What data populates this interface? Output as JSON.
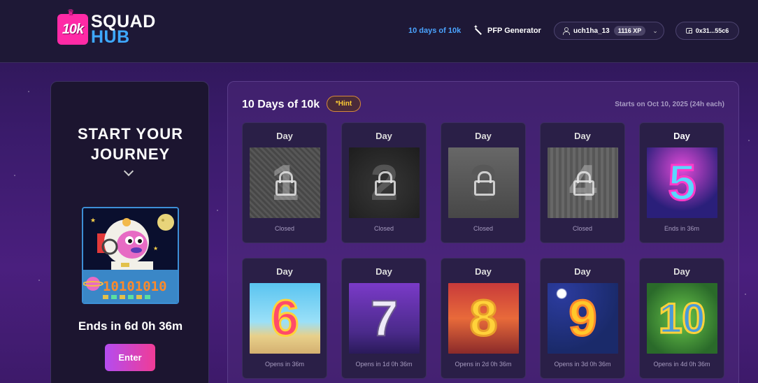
{
  "header": {
    "logo_badge": "10k",
    "logo_line1": "SQUAD",
    "logo_line2": "HUB",
    "nav_days": "10 days of 10k",
    "nav_pfp": "PFP Generator",
    "username": "uch1ha_13",
    "xp": "1116 XP",
    "wallet": "0x31...55c6"
  },
  "left": {
    "title_line1": "START YOUR",
    "title_line2": "JOURNEY",
    "nft_banner": "10101010",
    "ends": "Ends in 6d 0h 36m",
    "enter": "Enter"
  },
  "main": {
    "title": "10 Days of 10k",
    "hint": "*Hint",
    "starts": "Starts on Oct 10, 2025 (24h each)",
    "days": [
      {
        "label": "Day",
        "num": "1",
        "status": "Closed"
      },
      {
        "label": "Day",
        "num": "2",
        "status": "Closed"
      },
      {
        "label": "Day",
        "num": "3",
        "status": "Closed"
      },
      {
        "label": "Day",
        "num": "4",
        "status": "Closed"
      },
      {
        "label": "Day",
        "num": "5",
        "status": "Ends in 36m"
      },
      {
        "label": "Day",
        "num": "6",
        "status": "Opens in 36m"
      },
      {
        "label": "Day",
        "num": "7",
        "status": "Opens in 1d 0h 36m"
      },
      {
        "label": "Day",
        "num": "8",
        "status": "Opens in 2d 0h 36m"
      },
      {
        "label": "Day",
        "num": "9",
        "status": "Opens in 3d 0h 36m"
      },
      {
        "label": "Day",
        "num": "10",
        "status": "Opens in 4d 0h 36m"
      }
    ]
  },
  "colors": {
    "accent_blue": "#4aa3ff",
    "brand_pink": "#ff2aa6",
    "hint_yellow": "#ffcc33"
  }
}
